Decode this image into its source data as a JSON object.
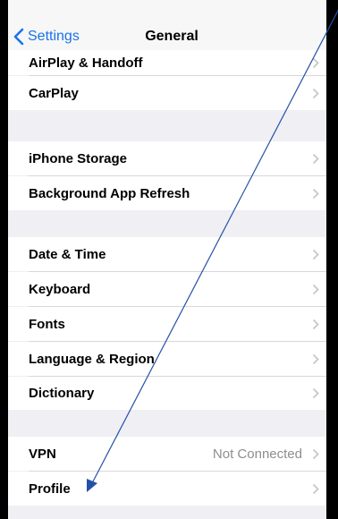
{
  "navbar": {
    "back_label": "Settings",
    "title": "General"
  },
  "rows": {
    "airplay": {
      "label": "AirPlay & Handoff"
    },
    "carplay": {
      "label": "CarPlay"
    },
    "iphone_storage": {
      "label": "iPhone Storage"
    },
    "background_refresh": {
      "label": "Background App Refresh"
    },
    "date_time": {
      "label": "Date & Time"
    },
    "keyboard": {
      "label": "Keyboard"
    },
    "fonts": {
      "label": "Fonts"
    },
    "language_region": {
      "label": "Language & Region"
    },
    "dictionary": {
      "label": "Dictionary"
    },
    "vpn": {
      "label": "VPN",
      "value": "Not Connected"
    },
    "profile": {
      "label": "Profile"
    }
  },
  "colors": {
    "accent": "#1a73e8",
    "background": "#efeff4",
    "cell": "#ffffff",
    "chevron": "#c7c7cc",
    "annotation_arrow": "#2451a6"
  },
  "icons": {
    "back": "chevron-left-icon",
    "disclosure": "chevron-right-icon"
  }
}
